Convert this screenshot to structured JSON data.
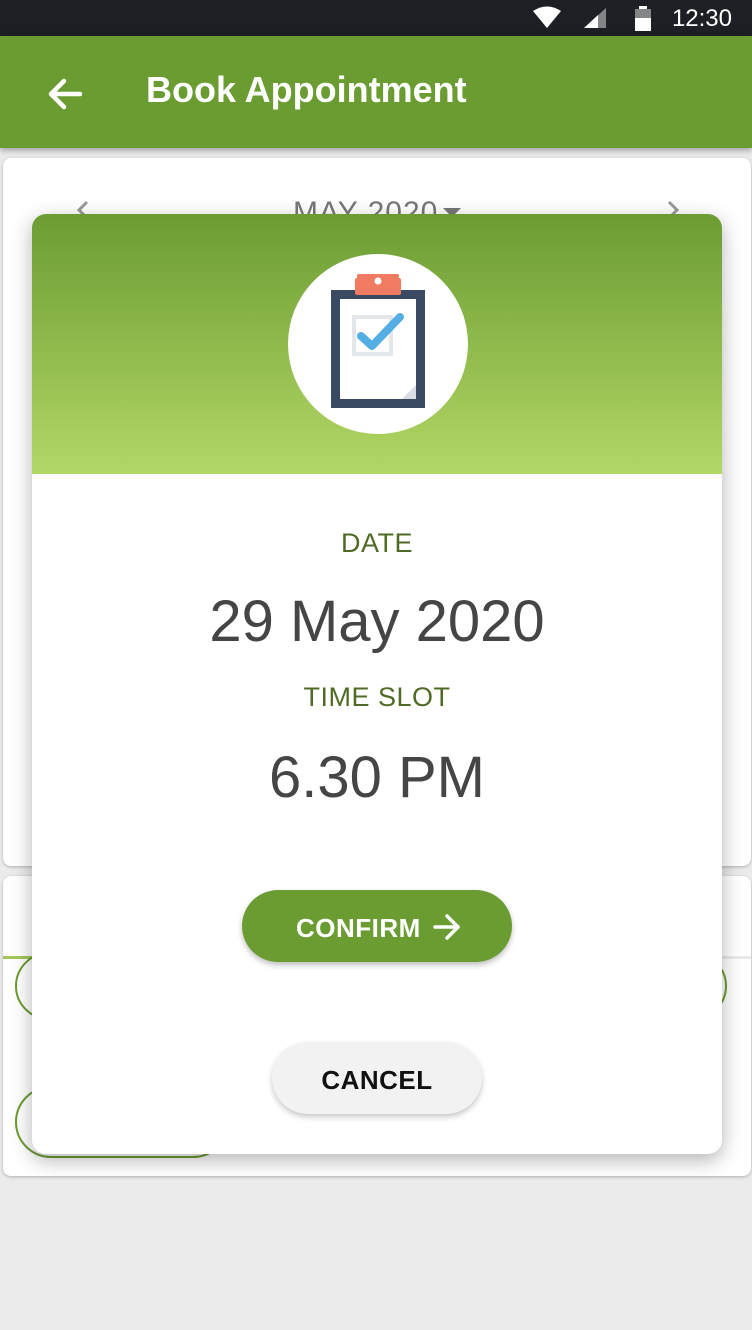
{
  "status_bar": {
    "time": "12:30"
  },
  "app_bar": {
    "title": "Book Appointment"
  },
  "calendar": {
    "month_label": "MAY 2020"
  },
  "dialog": {
    "date_label": "DATE",
    "date_value": "29 May 2020",
    "time_label": "TIME SLOT",
    "time_value": "6.30 PM",
    "confirm_label": "CONFIRM",
    "cancel_label": "CANCEL"
  },
  "colors": {
    "primary": "#6b9c32",
    "header_gradient_end": "#b3d766",
    "label_text": "#4f6a24",
    "value_text": "#454545"
  },
  "icons": {
    "back": "arrow-left-icon",
    "clipboard": "clipboard-check-icon",
    "confirm": "arrow-right-icon"
  }
}
